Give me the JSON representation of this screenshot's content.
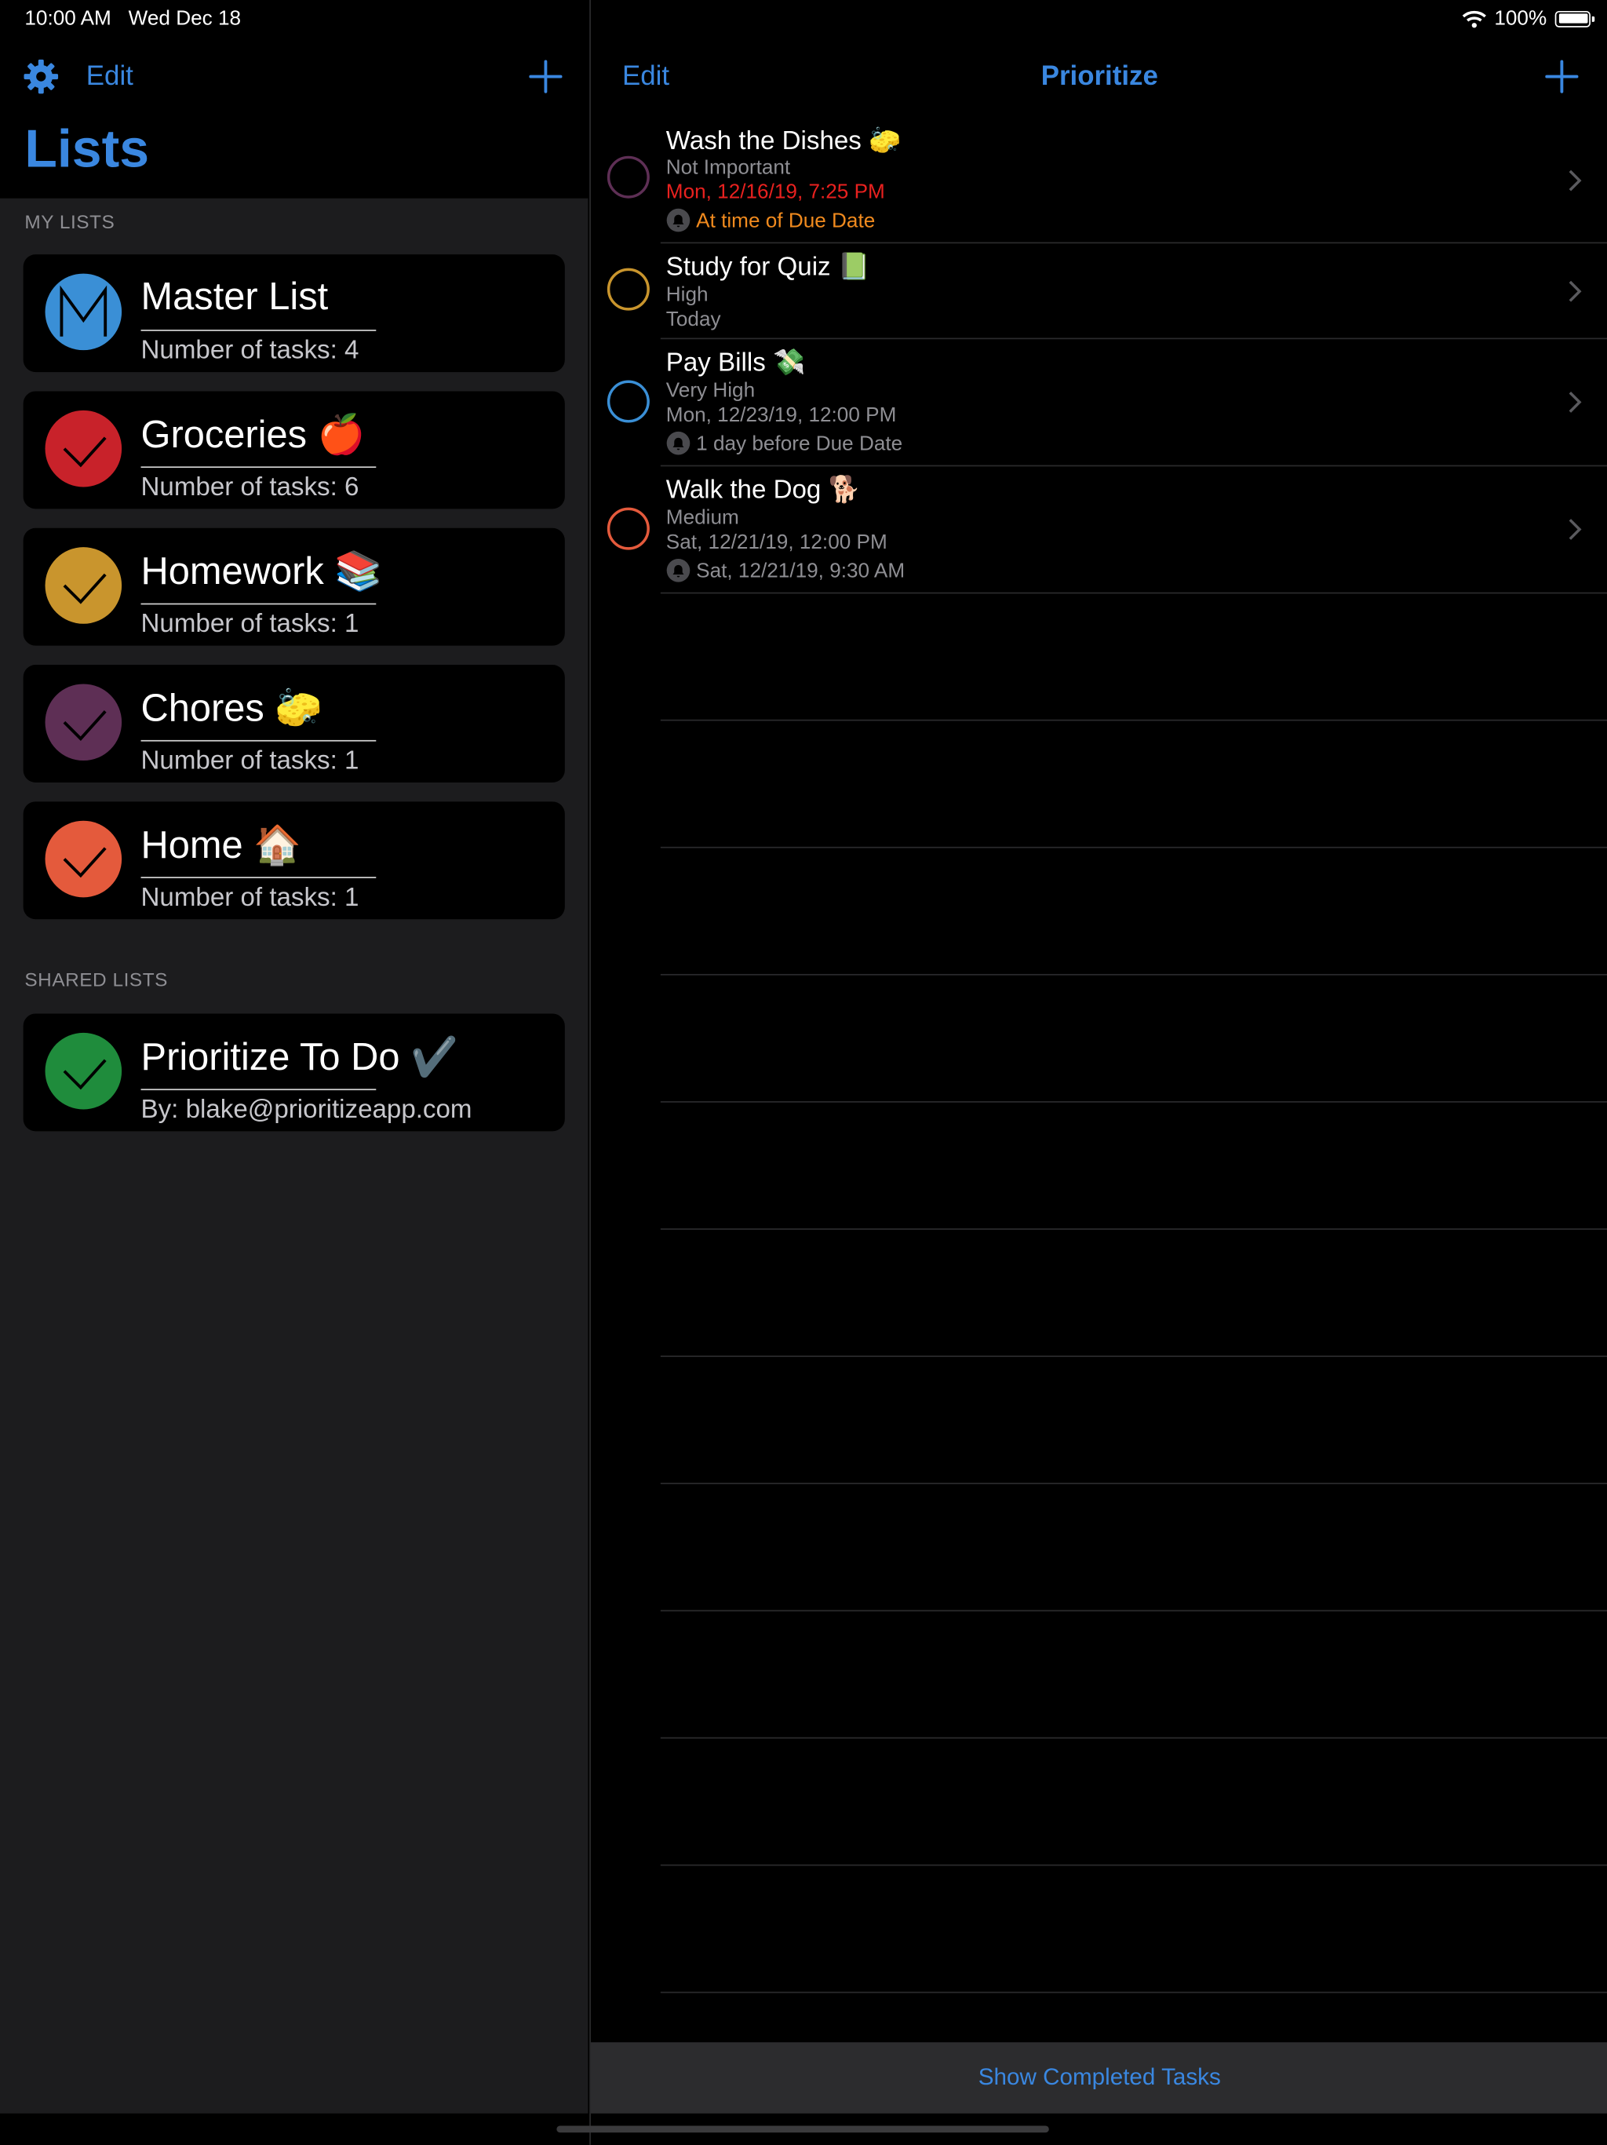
{
  "status_bar": {
    "time": "10:00 AM",
    "date": "Wed Dec 18",
    "battery": "100%"
  },
  "sidebar": {
    "edit_label": "Edit",
    "title": "Lists",
    "my_lists_label": "MY LISTS",
    "shared_lists_label": "SHARED LISTS",
    "my_lists": [
      {
        "name": "Master List",
        "sub": "Number of tasks: 4",
        "color": "#3a8fd6",
        "icon": "master-m-icon"
      },
      {
        "name": "Groceries 🍎",
        "sub": "Number of tasks: 6",
        "color": "#c8222a",
        "icon": "check-icon"
      },
      {
        "name": "Homework 📚",
        "sub": "Number of tasks: 1",
        "color": "#c9952d",
        "icon": "check-icon"
      },
      {
        "name": "Chores 🧽",
        "sub": "Number of tasks: 1",
        "color": "#5e2f55",
        "icon": "check-icon"
      },
      {
        "name": "Home 🏠",
        "sub": "Number of tasks: 1",
        "color": "#e45a3c",
        "icon": "check-icon"
      }
    ],
    "shared_lists": [
      {
        "name": "Prioritize To Do ✔️",
        "sub": "By: blake@prioritizeapp.com",
        "color": "#1f8c3c",
        "icon": "check-icon"
      }
    ]
  },
  "detail": {
    "edit_label": "Edit",
    "title": "Prioritize",
    "tasks": [
      {
        "title": "Wash the Dishes 🧽",
        "priority": "Not Important",
        "due": "Mon, 12/16/19, 7:25 PM",
        "due_color": "#e8211f",
        "reminder": "At time of Due Date",
        "reminder_color": "#f08a1e",
        "circle_color": "#5e2f55"
      },
      {
        "title": "Study for Quiz 📗",
        "priority": "High",
        "due": "Today",
        "due_color": "#8e8e93",
        "circle_color": "#c9952d"
      },
      {
        "title": "Pay Bills 💸",
        "priority": "Very High",
        "due": "Mon, 12/23/19, 12:00 PM",
        "due_color": "#8e8e93",
        "reminder": "1 day before Due Date",
        "reminder_color": "#8e8e93",
        "circle_color": "#3a8fd6"
      },
      {
        "title": "Walk the Dog 🐕",
        "priority": "Medium",
        "due": "Sat, 12/21/19, 12:00 PM",
        "due_color": "#8e8e93",
        "reminder": "Sat, 12/21/19, 9:30 AM",
        "reminder_color": "#8e8e93",
        "circle_color": "#e45a3c"
      }
    ],
    "show_completed_label": "Show Completed Tasks"
  }
}
